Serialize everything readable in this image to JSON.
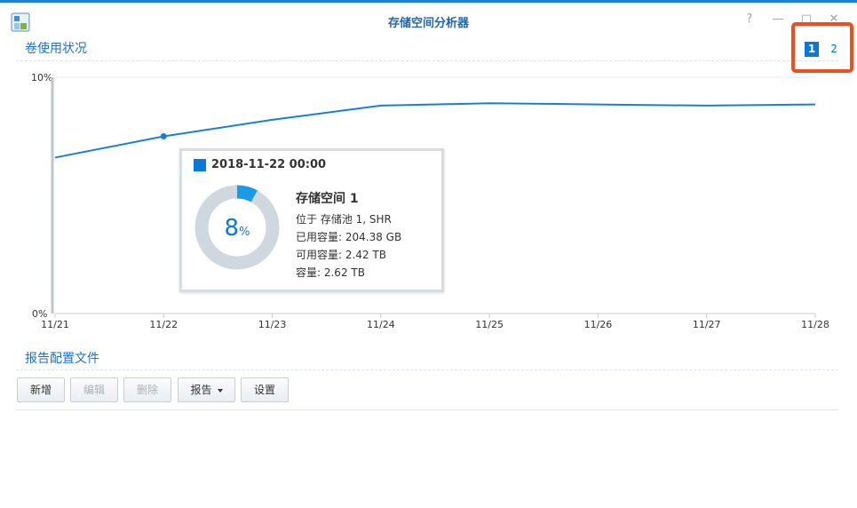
{
  "window": {
    "title": "存储空间分析器"
  },
  "window_controls": {
    "help": "?",
    "minimize": "—",
    "maximize": "□",
    "close": "✕"
  },
  "volume_section": {
    "title": "卷使用状况"
  },
  "pagination": {
    "pages": [
      "1",
      "2"
    ],
    "active": "1"
  },
  "chart_data": {
    "type": "line",
    "x": [
      "11/21",
      "11/22",
      "11/23",
      "11/24",
      "11/25",
      "11/26",
      "11/27",
      "11/28"
    ],
    "series": [
      {
        "values": [
          6.6,
          7.5,
          8.2,
          8.8,
          8.9,
          8.85,
          8.8,
          8.85
        ]
      }
    ],
    "ylim": [
      0,
      10
    ],
    "yticks": [
      "10%",
      "0%"
    ],
    "highlight_point": {
      "x": "11/22",
      "value": 7.5
    }
  },
  "tooltip": {
    "date": "2018-11-22 00:00",
    "percent": "8",
    "percent_symbol": "%",
    "usage_fraction": 0.08,
    "name": "存储空间 1",
    "location": "位于 存储池 1, SHR",
    "used": "已用容量:   204.38 GB",
    "available": "可用容量:   2.42 TB",
    "capacity": "容量:   2.62 TB"
  },
  "report_section": {
    "title": "报告配置文件"
  },
  "toolbar": {
    "new_label": "新增",
    "edit_label": "编辑",
    "delete_label": "删除",
    "report_label": "报告",
    "settings_label": "设置"
  },
  "colors": {
    "accent": "#0a78d6",
    "line": "#1a7fd4",
    "donut_track": "#d0d8df",
    "donut_fill": "#1a9be8",
    "highlight_box": "#f04e1e"
  }
}
